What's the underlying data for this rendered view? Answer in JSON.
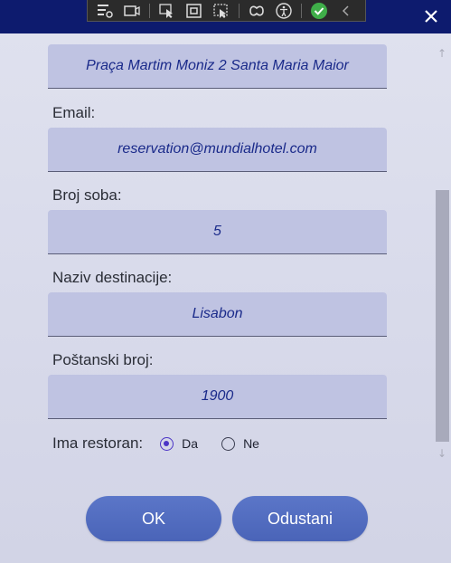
{
  "window": {
    "close_icon": "close-icon",
    "toolbar_icons": [
      "live-visual-tree-icon",
      "display-layout-adorners-icon",
      "select-element-icon",
      "track-focus-icon",
      "show-layout-icon",
      "binding-failures-icon",
      "accessibility-icon",
      "hot-reload-ok-icon",
      "collapse-icon"
    ]
  },
  "form": {
    "address_value": "Praça Martim Moniz 2 Santa Maria Maior",
    "email_label": "Email:",
    "email_value": "reservation@mundialhotel.com",
    "rooms_label": "Broj soba:",
    "rooms_value": "5",
    "destination_label": "Naziv destinacije:",
    "destination_value": "Lisabon",
    "postal_label": "Poštanski broj:",
    "postal_value": "1900",
    "restaurant_label": "Ima restoran:",
    "restaurant_options": [
      {
        "label": "Da",
        "selected": true
      },
      {
        "label": "Ne",
        "selected": false
      }
    ]
  },
  "buttons": {
    "ok_label": "OK",
    "cancel_label": "Odustani"
  },
  "colors": {
    "titlebar": "#0d1b6e",
    "field_bg": "#bfc3e2",
    "field_text": "#1a2a8a",
    "button": "#5068bb",
    "radio_accent": "#4b35c6"
  }
}
